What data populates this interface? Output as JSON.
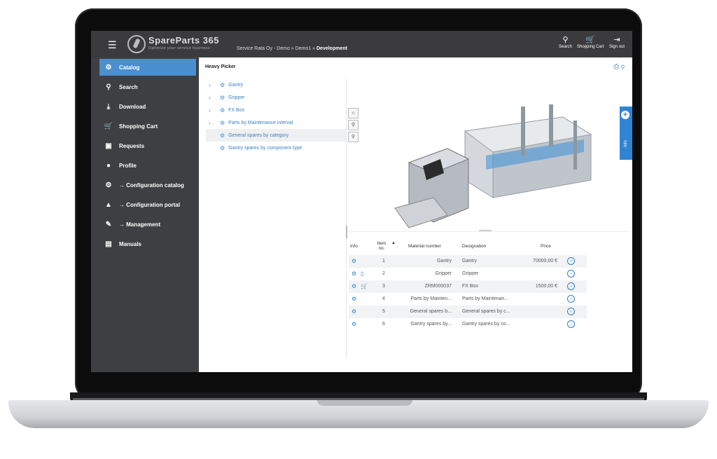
{
  "header": {
    "brand": "SpareParts 365",
    "tagline": "Optimize your service business",
    "breadcrumb_prefix": "Service Rata Oy - Demo  »  Demo1  »",
    "breadcrumb_current": "Development",
    "search_label": "Search",
    "cart_label": "Shopping Cart",
    "signout_label": "Sign out"
  },
  "sidebar": {
    "items": [
      {
        "label": "Catalog",
        "icon": "gears-icon",
        "active": true
      },
      {
        "label": "Search",
        "icon": "search-icon"
      },
      {
        "label": "Download",
        "icon": "download-icon"
      },
      {
        "label": "Shopping Cart",
        "icon": "cart-icon"
      },
      {
        "label": "Requests",
        "icon": "requests-icon"
      },
      {
        "label": "Profile",
        "icon": "user-icon"
      },
      {
        "label": "→ Configuration catalog",
        "icon": "gears-icon"
      },
      {
        "label": "→ Configuration portal",
        "icon": "users-icon"
      },
      {
        "label": "→ Management",
        "icon": "wrench-icon"
      },
      {
        "label": "Manuals",
        "icon": "book-icon"
      }
    ]
  },
  "main": {
    "title": "Heavy Picker",
    "tree": [
      {
        "label": "Gantry",
        "expandable": true
      },
      {
        "label": "Gripper",
        "expandable": true
      },
      {
        "label": "FX Box",
        "expandable": true
      },
      {
        "label": "Parts by Maintenance interval",
        "expandable": true
      },
      {
        "label": "General spares by category",
        "expandable": false
      },
      {
        "label": "Gantry spares by component type",
        "expandable": false
      }
    ],
    "info_tab_label": "Info"
  },
  "table": {
    "headers": {
      "info": "Info",
      "item_no": "Item no.",
      "material": "Material number",
      "designation": "Designation",
      "price": "Price"
    },
    "rows": [
      {
        "item": "1",
        "material": "Gantry",
        "designation": "Gantry",
        "price": "70000,00 €",
        "extra_icon": ""
      },
      {
        "item": "2",
        "material": "Gripper",
        "designation": "Gripper",
        "price": "",
        "extra_icon": "document-icon"
      },
      {
        "item": "3",
        "material": "ZRM000037",
        "designation": "FX Box",
        "price": "1500,00 €",
        "extra_icon": "cart-icon"
      },
      {
        "item": "4",
        "material": "Parts by Mainten...",
        "designation": "Parts by Maintenan...",
        "price": "",
        "extra_icon": ""
      },
      {
        "item": "5",
        "material": "General spares b...",
        "designation": "General spares by c...",
        "price": "",
        "extra_icon": ""
      },
      {
        "item": "6",
        "material": "Gantry spares by...",
        "designation": "Gantry spares by co...",
        "price": "",
        "extra_icon": ""
      }
    ]
  },
  "colors": {
    "accent": "#4a8fcf",
    "sidebar": "#3e3f42",
    "header": "#3b3b3d"
  }
}
